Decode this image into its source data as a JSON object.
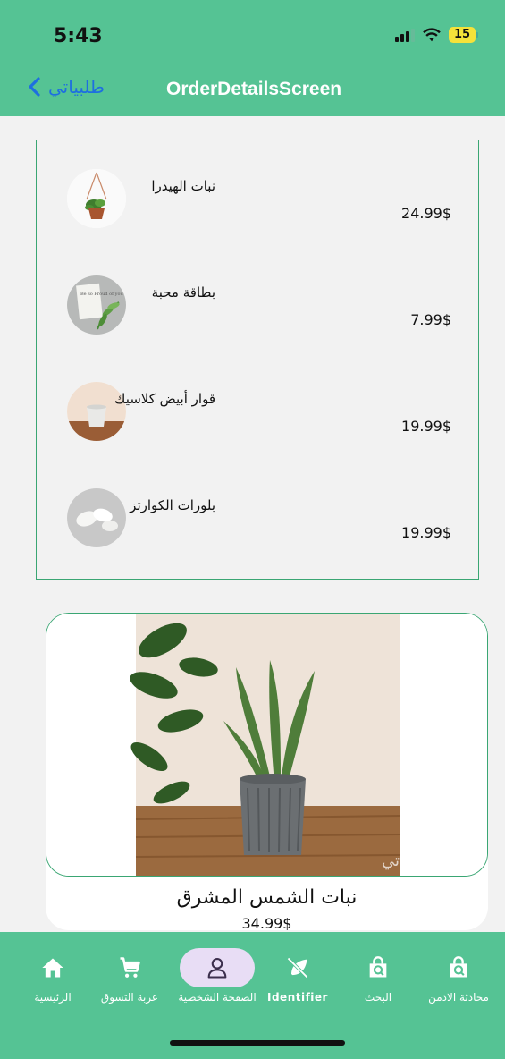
{
  "status": {
    "time": "5:43",
    "battery": "15"
  },
  "header": {
    "back_label": "طلبياتي",
    "title": "OrderDetailsScreen"
  },
  "order_items": [
    {
      "name": "نبات الهيدرا",
      "price": "24.99$"
    },
    {
      "name": "بطاقة محبة",
      "price": "7.99$"
    },
    {
      "name": "قوار أبيض كلاسيك",
      "price": "19.99$"
    },
    {
      "name": "بلورات الكوارتز",
      "price": "19.99$"
    }
  ],
  "card_text": "Be so Proud of you",
  "watermark": "نباتاتي",
  "featured": {
    "name": "نبات الشمس المشرق",
    "price": "34.99$"
  },
  "bottom_nav": [
    {
      "label": "الرئيسية",
      "icon": "home-icon"
    },
    {
      "label": "عربة التسوق",
      "icon": "cart-icon"
    },
    {
      "label": "الصفحة الشخصية",
      "icon": "person-icon",
      "active": true
    },
    {
      "label": "Identifier",
      "icon": "leaf-off-icon"
    },
    {
      "label": "البحث",
      "icon": "bag-search-icon"
    },
    {
      "label": "محادثة الادمن",
      "icon": "bag-search-icon"
    }
  ],
  "colors": {
    "header": "#55c394",
    "accent_border": "#3aa673",
    "back_link": "#1e6fe0",
    "active_pill": "#e8ddf5"
  }
}
